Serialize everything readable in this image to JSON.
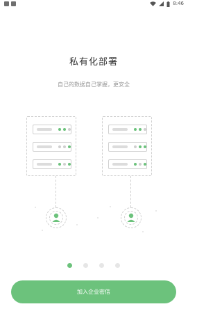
{
  "status_bar": {
    "time": "8:46"
  },
  "intro": {
    "title": "私有化部署",
    "subtitle": "自己的数据自己掌握，更安全"
  },
  "pager": {
    "count": 4,
    "active_index": 0
  },
  "actions": {
    "join_label": "加入企业密信"
  },
  "colors": {
    "accent": "#6cc27c",
    "inactive_dot": "#e6e6e6"
  }
}
